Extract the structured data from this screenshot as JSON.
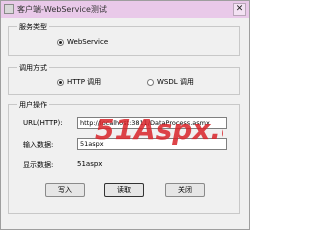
{
  "window": {
    "title": "客户端-WebService测试",
    "close_glyph": "✕"
  },
  "service_type": {
    "legend": "服务类型",
    "option_webservice": "WebService"
  },
  "call_mode": {
    "legend": "调用方式",
    "option_http": "HTTP 调用",
    "option_wsdl": "WSDL 调用",
    "selected": "HTTP 调用"
  },
  "user_ops": {
    "legend": "用户操作",
    "url_label": "URL(HTTP):",
    "url_value": "http://localhost:3811/DataProcess.asmx",
    "input_label": "输入数据:",
    "input_value": "51aspx",
    "display_label": "显示数据:",
    "display_value": "51aspx"
  },
  "buttons": {
    "write": "写入",
    "read": "读取",
    "close": "关闭"
  },
  "watermark": {
    "text": "51Aspx.com",
    "color": "#d9242a"
  }
}
